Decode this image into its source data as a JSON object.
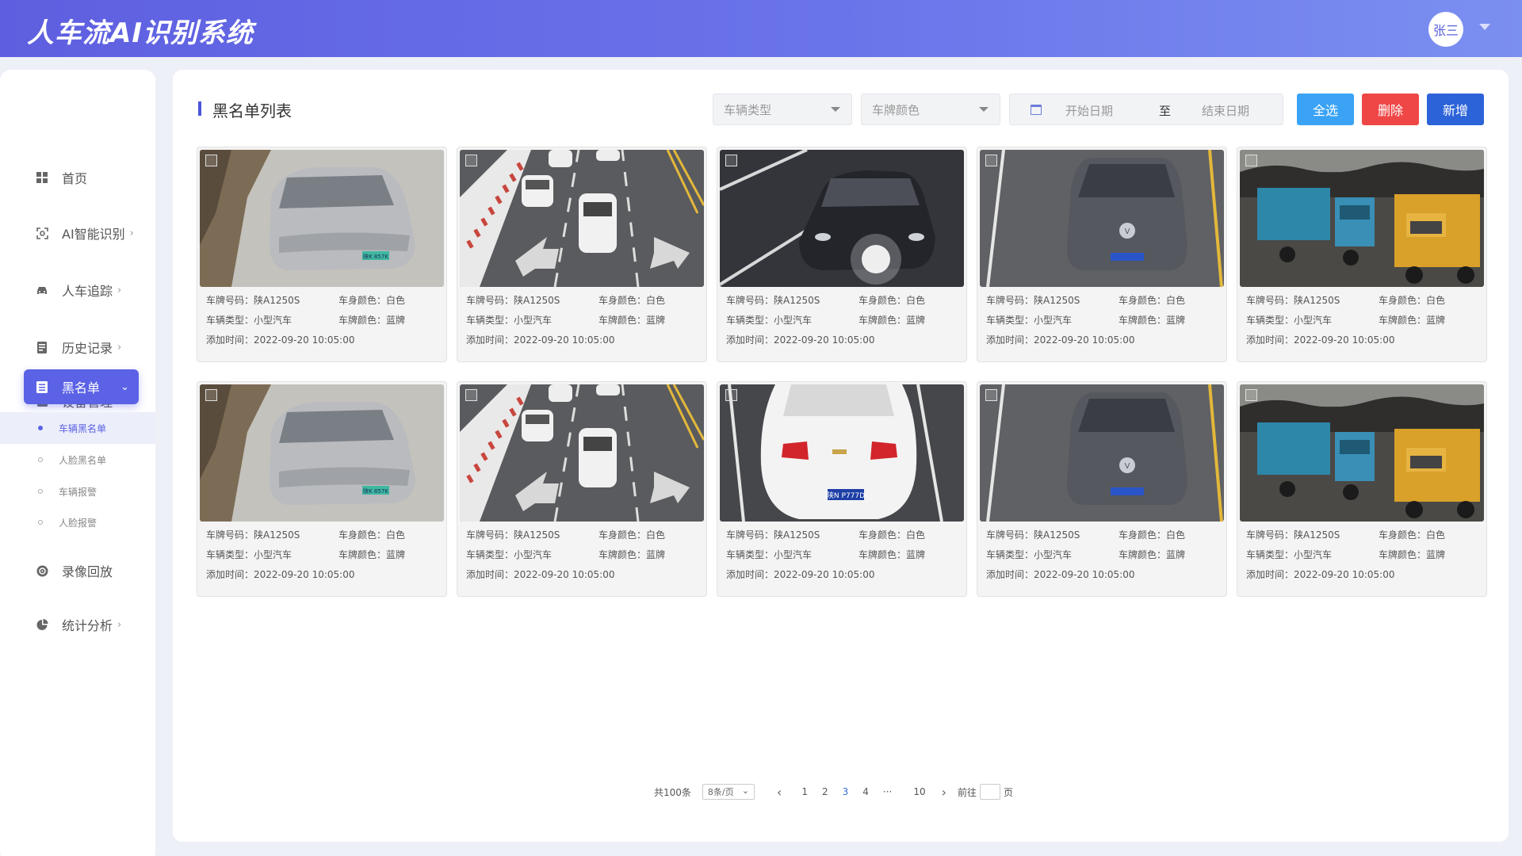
{
  "header": {
    "app_title": "人车流AI识别系统",
    "user_name": "张三"
  },
  "sidebar": {
    "items": [
      {
        "label": "首页",
        "icon": "grid-icon",
        "has_arrow": false
      },
      {
        "label": "AI智能识别",
        "icon": "scan-icon",
        "has_arrow": true
      },
      {
        "label": "人车追踪",
        "icon": "car-icon",
        "has_arrow": true
      },
      {
        "label": "历史记录",
        "icon": "history-icon",
        "has_arrow": true
      },
      {
        "label": "设备管理",
        "icon": "device-icon",
        "has_arrow": false
      },
      {
        "label": "黑名单",
        "icon": "list-icon",
        "has_arrow": true,
        "active": true
      },
      {
        "label": "录像回放",
        "icon": "playback-icon",
        "has_arrow": false
      },
      {
        "label": "统计分析",
        "icon": "pie-icon",
        "has_arrow": true
      }
    ],
    "sub_items": [
      {
        "label": "车辆黑名单",
        "active": true
      },
      {
        "label": "人脸黑名单"
      },
      {
        "label": "车辆报警"
      },
      {
        "label": "人脸报警"
      }
    ]
  },
  "main": {
    "title": "黑名单列表",
    "filters": {
      "vehicle_type_placeholder": "车辆类型",
      "plate_color_placeholder": "车牌颜色",
      "start_date_placeholder": "开始日期",
      "date_separator": "至",
      "end_date_placeholder": "结束日期"
    },
    "buttons": {
      "select_all": "全选",
      "delete": "删除",
      "add": "新增"
    },
    "field_labels": {
      "plate": "车牌号码：",
      "body_color": "车身颜色：",
      "type": "车辆类型：",
      "plate_color": "车牌颜色：",
      "added": "添加时间："
    },
    "cards": [
      {
        "scene": "silver-sedan",
        "plate": "陕A1250S",
        "body_color": "白色",
        "type": "小型汽车",
        "plate_color": "蓝牌",
        "added": "2022-09-20 10:05:00"
      },
      {
        "scene": "road-white-cars",
        "plate": "陕A1250S",
        "body_color": "白色",
        "type": "小型汽车",
        "plate_color": "蓝牌",
        "added": "2022-09-20 10:05:00"
      },
      {
        "scene": "night-sedan",
        "plate": "陕A1250S",
        "body_color": "白色",
        "type": "小型汽车",
        "plate_color": "蓝牌",
        "added": "2022-09-20 10:05:00"
      },
      {
        "scene": "vw-hatch",
        "plate": "陕A1250S",
        "body_color": "白色",
        "type": "小型汽车",
        "plate_color": "蓝牌",
        "added": "2022-09-20 10:05:00"
      },
      {
        "scene": "coal-trucks",
        "plate": "陕A1250S",
        "body_color": "白色",
        "type": "小型汽车",
        "plate_color": "蓝牌",
        "added": "2022-09-20 10:05:00"
      },
      {
        "scene": "silver-sedan",
        "plate": "陕A1250S",
        "body_color": "白色",
        "type": "小型汽车",
        "plate_color": "蓝牌",
        "added": "2022-09-20 10:05:00"
      },
      {
        "scene": "road-white-cars",
        "plate": "陕A1250S",
        "body_color": "白色",
        "type": "小型汽车",
        "plate_color": "蓝牌",
        "added": "2022-09-20 10:05:00"
      },
      {
        "scene": "white-chevrolet",
        "plate": "陕A1250S",
        "body_color": "白色",
        "type": "小型汽车",
        "plate_color": "蓝牌",
        "added": "2022-09-20 10:05:00"
      },
      {
        "scene": "vw-hatch",
        "plate": "陕A1250S",
        "body_color": "白色",
        "type": "小型汽车",
        "plate_color": "蓝牌",
        "added": "2022-09-20 10:05:00"
      },
      {
        "scene": "coal-trucks",
        "plate": "陕A1250S",
        "body_color": "白色",
        "type": "小型汽车",
        "plate_color": "蓝牌",
        "added": "2022-09-20 10:05:00"
      }
    ],
    "photo_plates": {
      "silver-sedan": "陕K 857K",
      "white-chevrolet": "陕N P777D"
    }
  },
  "pagination": {
    "total": "共100条",
    "page_size": "8条/页",
    "pages": [
      "1",
      "2",
      "3",
      "4",
      "···",
      "10"
    ],
    "current": "3",
    "goto_label": "前往",
    "goto_suffix": "页"
  },
  "colors": {
    "accent": "#5b62e6",
    "select_all": "#3aa3f5",
    "delete": "#ef4646",
    "add": "#2d63d9"
  }
}
